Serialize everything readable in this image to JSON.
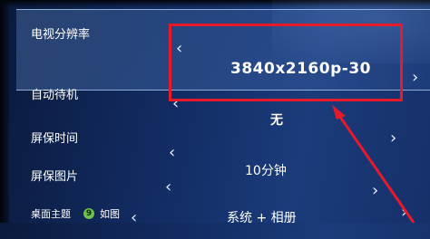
{
  "settings": {
    "rows": [
      {
        "label": "电视分辨率",
        "value": "3840x2160p-30",
        "selected": true
      },
      {
        "label": "自动待机",
        "value": "无"
      },
      {
        "label": "屏保时间",
        "value": ""
      },
      {
        "label": "屏保图片",
        "value": "10分钟"
      },
      {
        "label": "桌面主题",
        "badge": "9",
        "label_suffix": "如图",
        "value": "系统 + 相册"
      }
    ],
    "nav": {
      "prev_glyph": "‹",
      "next_glyph": "›"
    }
  },
  "annotation": {
    "color": "#e81a2a"
  }
}
